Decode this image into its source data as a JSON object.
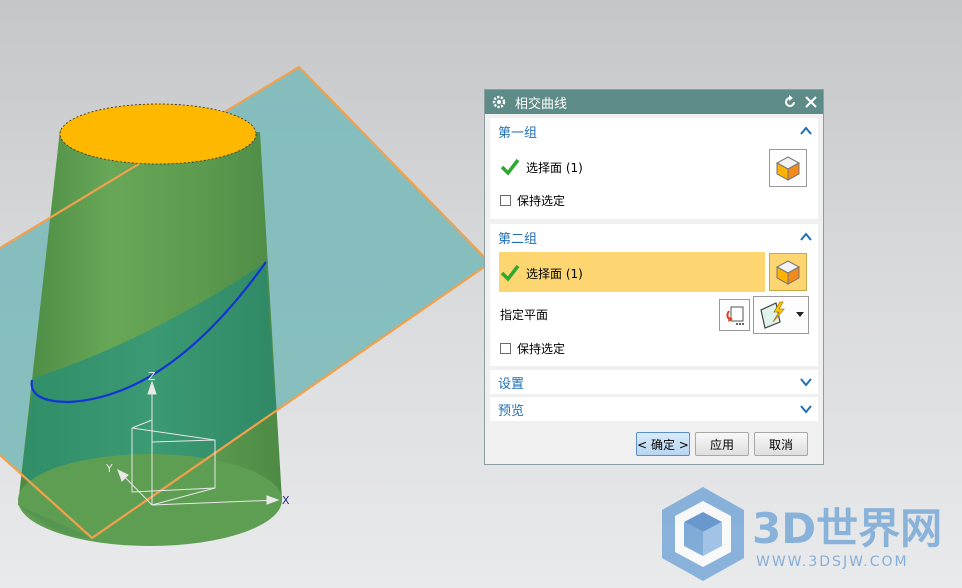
{
  "dialog": {
    "title": "相交曲线",
    "group1": {
      "header": "第一组",
      "select_face": "选择面 (1)",
      "keep_selected": "保持选定"
    },
    "group2": {
      "header": "第二组",
      "select_face": "选择面 (1)",
      "specify_plane": "指定平面",
      "keep_selected": "保持选定"
    },
    "settings": "设置",
    "preview": "预览",
    "buttons": {
      "ok": "< 确定 >",
      "apply": "应用",
      "cancel": "取消"
    }
  },
  "viewport": {
    "axis_x": "X",
    "axis_y": "Y",
    "axis_z": "Z"
  },
  "watermark": {
    "logo_text": "3D世界网",
    "url": "WWW.3DSJW.COM"
  },
  "colors": {
    "title_bar": "#5d8b87",
    "active_row": "#fdd672",
    "group_header_text": "#1f6fb5",
    "plane_fill": "#7fbcbc",
    "plane_edge": "#f2a04b",
    "cone_green": "#5f9f52",
    "cone_top": "#ffb800",
    "intersection_curve": "#1433d6"
  }
}
